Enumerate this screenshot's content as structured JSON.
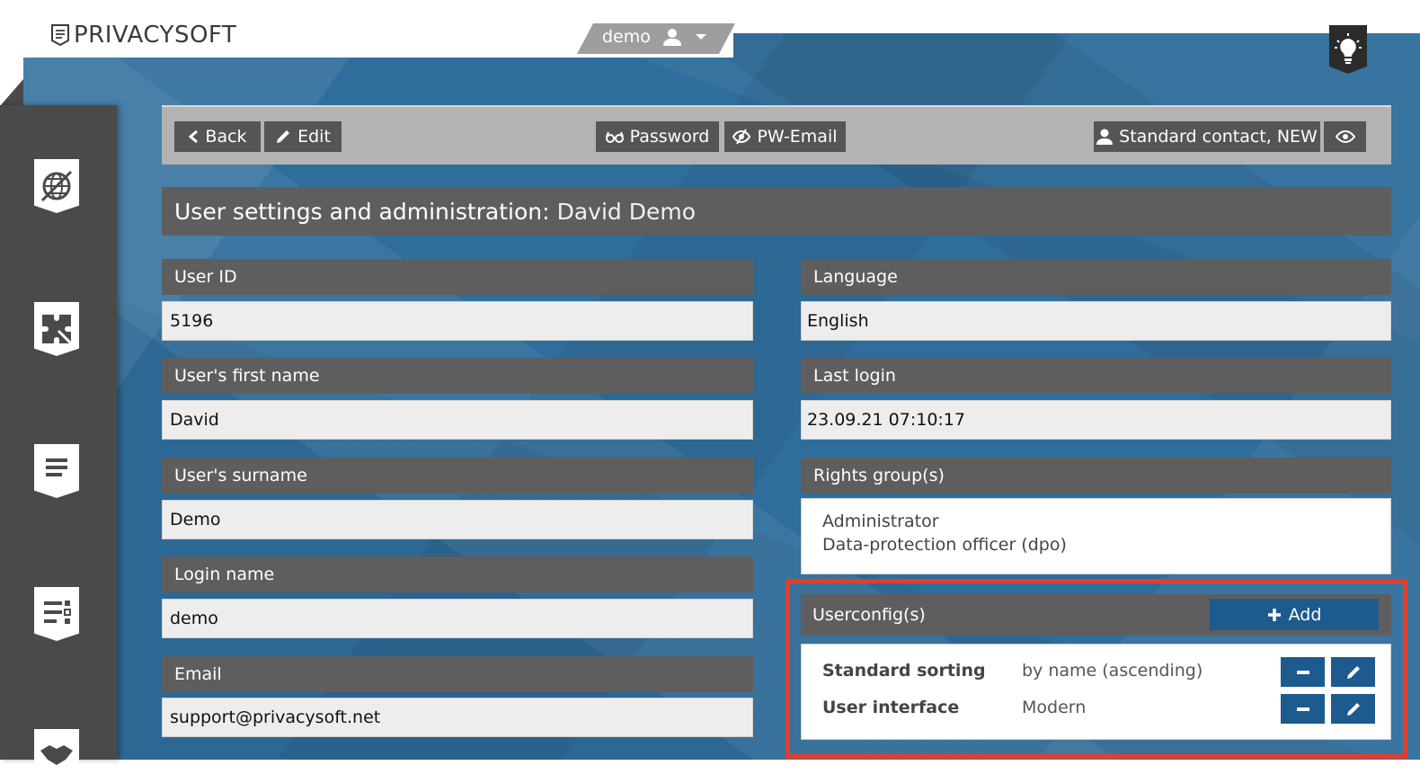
{
  "brand": {
    "logo_text": "PRIVACYSOFT"
  },
  "user_menu": {
    "username": "demo"
  },
  "toolbar": {
    "back_label": "Back",
    "edit_label": "Edit",
    "password_label": "Password",
    "pw_email_label": "PW-Email",
    "contact_label": "Standard contact, NEW"
  },
  "page": {
    "title_prefix": "User settings and administration:",
    "title_name": "David Demo"
  },
  "fields": {
    "user_id": {
      "label": "User ID",
      "value": "5196"
    },
    "first_name": {
      "label": "User's first name",
      "value": "David"
    },
    "surname": {
      "label": "User's surname",
      "value": "Demo"
    },
    "login_name": {
      "label": "Login name",
      "value": "demo"
    },
    "email": {
      "label": "Email",
      "value": "support@privacysoft.net"
    },
    "language": {
      "label": "Language",
      "value": "English"
    },
    "last_login": {
      "label": "Last login",
      "value": "23.09.21 07:10:17"
    },
    "rights_groups": {
      "label": "Rights group(s)",
      "values": [
        "Administrator",
        "Data-protection officer (dpo)"
      ]
    }
  },
  "userconfig": {
    "label": "Userconfig(s)",
    "add_label": "Add",
    "rows": [
      {
        "key": "Standard sorting",
        "value": "by name (ascending)"
      },
      {
        "key": "User interface",
        "value": "Modern"
      }
    ]
  },
  "icons": {
    "sidebar": [
      "globe-icon",
      "puzzle-icon",
      "document-icon",
      "checklist-icon",
      "handshake-icon"
    ],
    "header": [
      "user-icon",
      "caret-down-icon",
      "lightbulb-icon"
    ],
    "toolbar": [
      "chevron-left-icon",
      "pencil-icon",
      "glasses-icon",
      "eye-slash-icon",
      "user-icon",
      "eye-icon"
    ]
  },
  "colors": {
    "accent_blue": "#1d5a8e",
    "background_blue": "#2f6e9c",
    "label_gray": "#5e5e5e",
    "highlight_red": "#e0402b"
  }
}
